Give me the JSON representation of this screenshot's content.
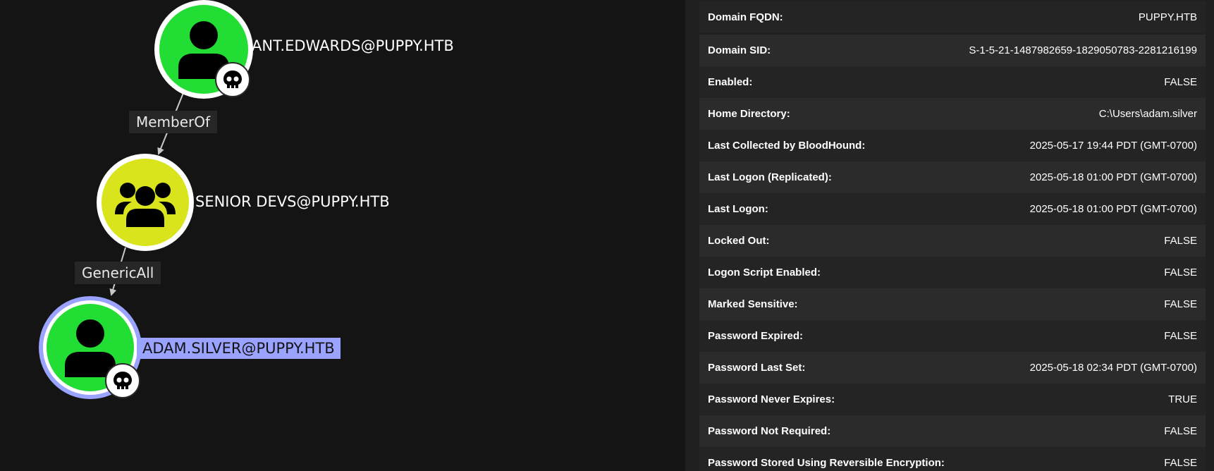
{
  "graph": {
    "nodes": [
      {
        "id": "ant",
        "label": "ANT.EDWARDS@PUPPY.HTB",
        "type": "user",
        "owned": true,
        "color": "#22dd33"
      },
      {
        "id": "devs",
        "label": "SENIOR DEVS@PUPPY.HTB",
        "type": "group",
        "owned": false,
        "color": "#d9e41c"
      },
      {
        "id": "adam",
        "label": "ADAM.SILVER@PUPPY.HTB",
        "type": "user",
        "owned": true,
        "selected": true,
        "color": "#22dd33"
      }
    ],
    "edges": [
      {
        "from": "ant",
        "to": "devs",
        "label": "MemberOf"
      },
      {
        "from": "devs",
        "to": "adam",
        "label": "GenericAll"
      }
    ],
    "selection_color": "#9aa3ff",
    "icons": {
      "user": "user-icon",
      "group": "group-icon",
      "owned": "skull-icon"
    }
  },
  "properties": [
    {
      "key": "Domain FQDN:",
      "value": "PUPPY.HTB"
    },
    {
      "key": "Domain SID:",
      "value": "S-1-5-21-1487982659-1829050783-2281216199"
    },
    {
      "key": "Enabled:",
      "value": "FALSE"
    },
    {
      "key": "Home Directory:",
      "value": "C:\\Users\\adam.silver"
    },
    {
      "key": "Last Collected by BloodHound:",
      "value": "2025-05-17 19:44 PDT (GMT-0700)"
    },
    {
      "key": "Last Logon (Replicated):",
      "value": "2025-05-18 01:00 PDT (GMT-0700)"
    },
    {
      "key": "Last Logon:",
      "value": "2025-05-18 01:00 PDT (GMT-0700)"
    },
    {
      "key": "Locked Out:",
      "value": "FALSE"
    },
    {
      "key": "Logon Script Enabled:",
      "value": "FALSE"
    },
    {
      "key": "Marked Sensitive:",
      "value": "FALSE"
    },
    {
      "key": "Password Expired:",
      "value": "FALSE"
    },
    {
      "key": "Password Last Set:",
      "value": "2025-05-18 02:34 PDT (GMT-0700)"
    },
    {
      "key": "Password Never Expires:",
      "value": "TRUE"
    },
    {
      "key": "Password Not Required:",
      "value": "FALSE"
    },
    {
      "key": "Password Stored Using Reversible Encryption:",
      "value": "FALSE"
    }
  ]
}
